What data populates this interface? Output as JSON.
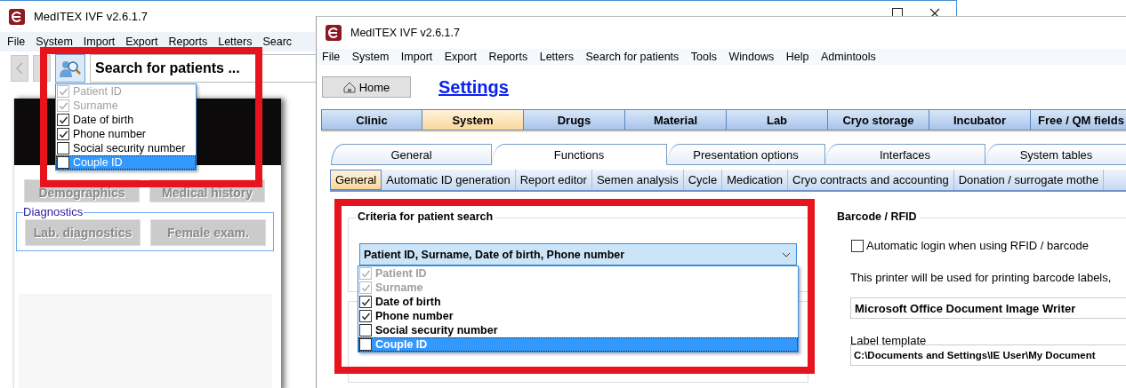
{
  "back_window": {
    "title": "MedITEX IVF v2.6.1.7",
    "menu": [
      "File",
      "System",
      "Import",
      "Export",
      "Reports",
      "Letters",
      "Searc"
    ],
    "search": {
      "value": "Search for patients ..."
    },
    "search_options": [
      {
        "label": "Patient ID",
        "checked": true,
        "disabled": true,
        "selected": false
      },
      {
        "label": "Surname",
        "checked": true,
        "disabled": true,
        "selected": false
      },
      {
        "label": "Date of birth",
        "checked": true,
        "disabled": false,
        "selected": false
      },
      {
        "label": "Phone number",
        "checked": true,
        "disabled": false,
        "selected": false
      },
      {
        "label": "Social security number",
        "checked": false,
        "disabled": false,
        "selected": false
      },
      {
        "label": "Couple ID",
        "checked": false,
        "disabled": false,
        "selected": true
      }
    ],
    "buttons": [
      "Demographics",
      "Medical history"
    ],
    "diagnostics": {
      "title": "Diagnostics",
      "buttons": [
        "Lab. diagnostics",
        "Female exam."
      ]
    }
  },
  "front_window": {
    "title": "MedITEX IVF v2.6.1.7",
    "menu": [
      "File",
      "System",
      "Import",
      "Export",
      "Reports",
      "Letters",
      "Search for patients",
      "Tools",
      "Windows",
      "Help",
      "Admintools"
    ],
    "home_button": "Home",
    "page_title": "Settings",
    "tabs": [
      {
        "label": "Clinic",
        "selected": false
      },
      {
        "label": "System",
        "selected": true
      },
      {
        "label": "Drugs",
        "selected": false
      },
      {
        "label": "Material",
        "selected": false
      },
      {
        "label": "Lab",
        "selected": false
      },
      {
        "label": "Cryo storage",
        "selected": false
      },
      {
        "label": "Incubator",
        "selected": false
      },
      {
        "label": "Free / QM fields",
        "selected": false
      }
    ],
    "subtabs": [
      {
        "label": "General",
        "selected": false
      },
      {
        "label": "Functions",
        "selected": true
      },
      {
        "label": "Presentation options",
        "selected": false
      },
      {
        "label": "Interfaces",
        "selected": false
      },
      {
        "label": "System tables",
        "selected": false
      }
    ],
    "section_tabs": [
      {
        "label": "General",
        "selected": true
      },
      {
        "label": "Automatic ID generation",
        "selected": false
      },
      {
        "label": "Report editor",
        "selected": false
      },
      {
        "label": "Semen analysis",
        "selected": false
      },
      {
        "label": "Cycle",
        "selected": false
      },
      {
        "label": "Medication",
        "selected": false
      },
      {
        "label": "Cryo contracts and accounting",
        "selected": false
      },
      {
        "label": "Donation / surrogate mothe",
        "selected": false
      }
    ],
    "patient_search": {
      "title": "Criteria for patient search",
      "value": "Patient ID, Surname, Date of birth, Phone number",
      "options": [
        {
          "label": "Patient ID",
          "checked": true,
          "disabled": true,
          "selected": false
        },
        {
          "label": "Surname",
          "checked": true,
          "disabled": true,
          "selected": false
        },
        {
          "label": "Date of birth",
          "checked": true,
          "disabled": false,
          "selected": false
        },
        {
          "label": "Phone number",
          "checked": true,
          "disabled": false,
          "selected": false
        },
        {
          "label": "Social security number",
          "checked": false,
          "disabled": false,
          "selected": false
        },
        {
          "label": "Couple ID",
          "checked": false,
          "disabled": false,
          "selected": true
        }
      ]
    },
    "barcode": {
      "title": "Barcode / RFID",
      "auto_login": {
        "label": "Automatic login when using RFID / barcode",
        "checked": false
      },
      "printer_note": "This printer will be used for printing barcode labels,",
      "printer": "Microsoft Office Document Image Writer",
      "label_template_label": "Label template",
      "label_template": "C:\\Documents and Settings\\IE User\\My Document"
    }
  }
}
